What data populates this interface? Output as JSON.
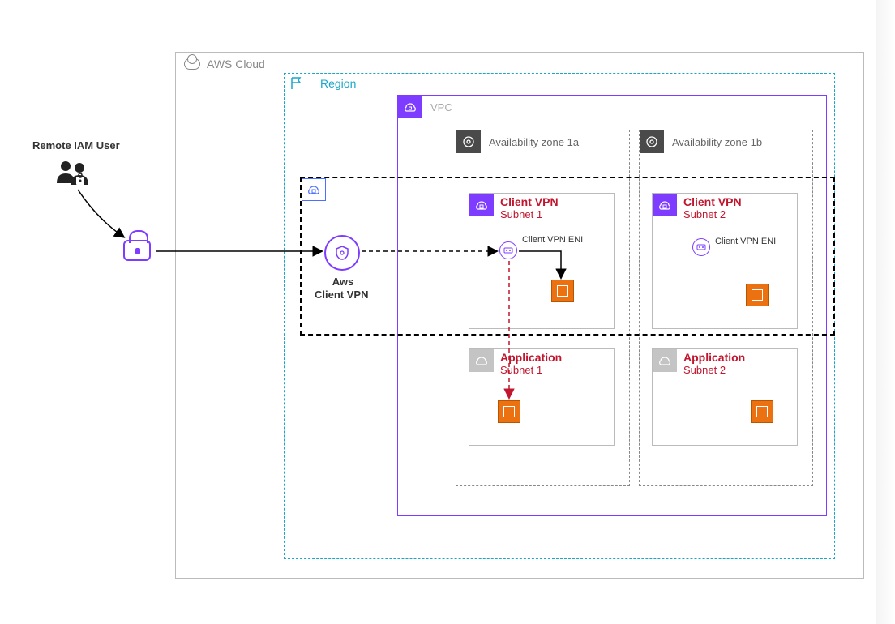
{
  "remote_user": {
    "label": "Remote IAM User"
  },
  "aws_cloud": {
    "label": "AWS Cloud"
  },
  "region": {
    "label": "Region"
  },
  "vpc": {
    "label": "VPC"
  },
  "client_vpn_box": {
    "title": "Aws",
    "subtitle": "Client VPN"
  },
  "az": {
    "a": "Availability zone 1a",
    "b": "Availability zone 1b"
  },
  "subnets": {
    "cvpn1": {
      "title": "Client VPN",
      "sub": "Subnet 1"
    },
    "cvpn2": {
      "title": "Client VPN",
      "sub": "Subnet 2"
    },
    "app1": {
      "title": "Application",
      "sub": "Subnet 1"
    },
    "app2": {
      "title": "Application",
      "sub": "Subnet 2"
    }
  },
  "eni": {
    "label": "Client VPN ENI"
  }
}
